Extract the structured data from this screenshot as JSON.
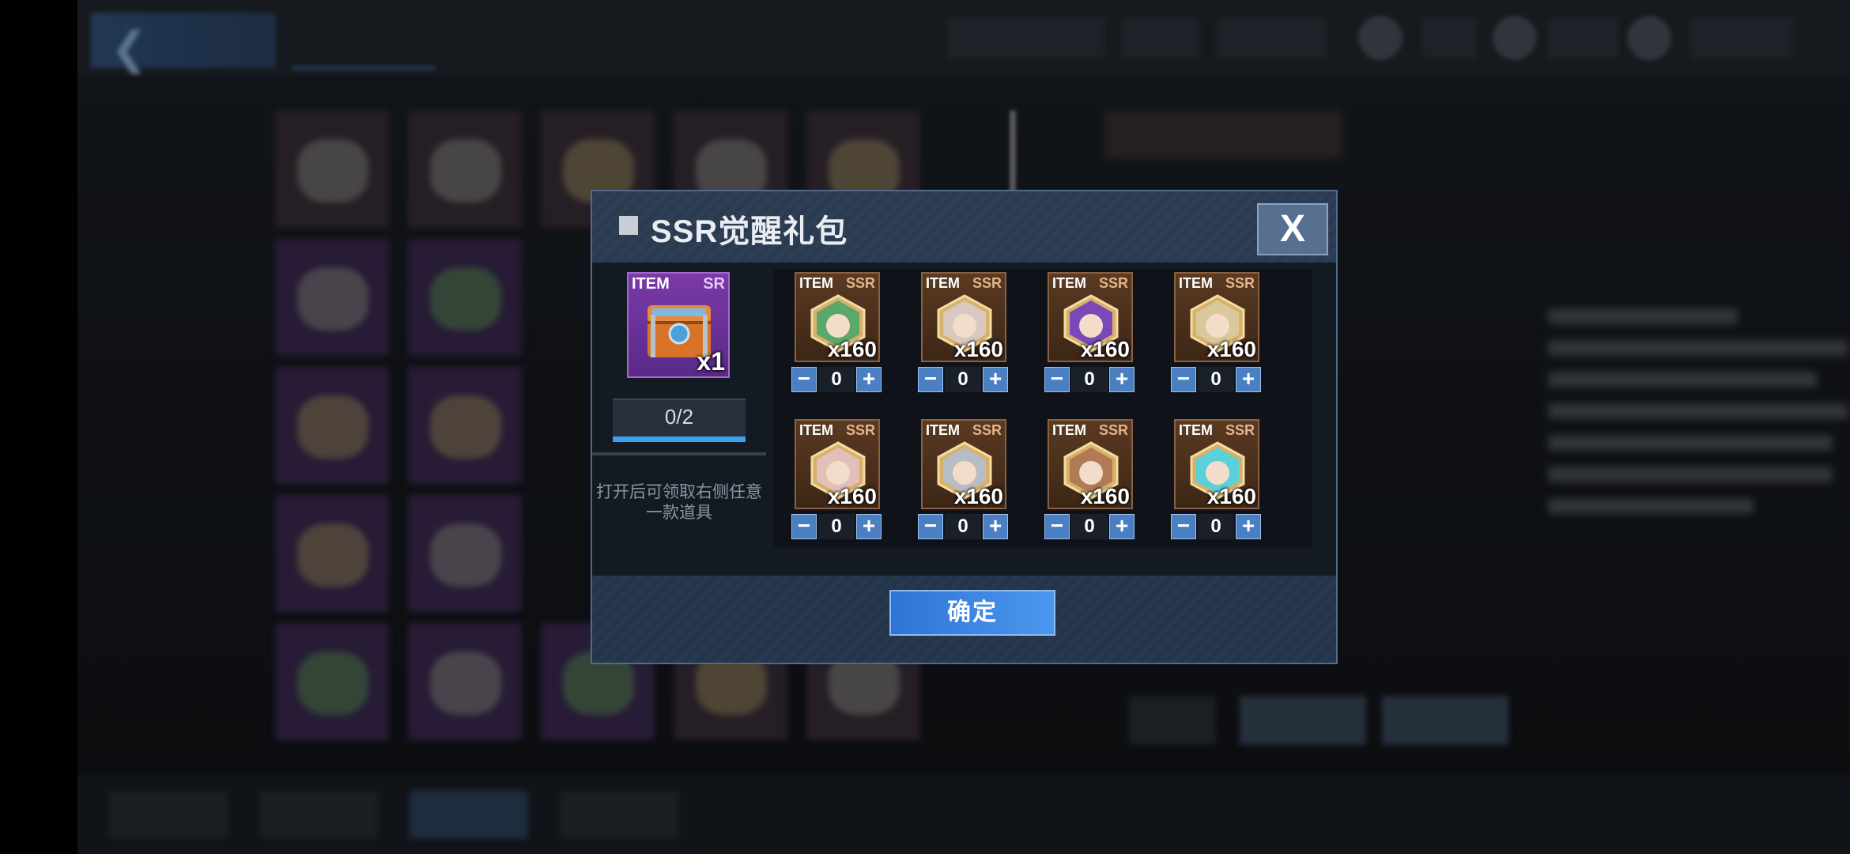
{
  "dialog": {
    "title": "SSR觉醒礼包",
    "close_label": "X",
    "confirm_label": "确定"
  },
  "source_item": {
    "tag": "ITEM",
    "rarity": "SR",
    "quantity": "x1",
    "icon": "treasure-chest-icon",
    "progress_text": "0/2",
    "progress_value": 0,
    "hint": "打开后可领取右侧任意一款道具"
  },
  "choices": [
    {
      "tag": "ITEM",
      "rarity": "SSR",
      "quantity": "x160",
      "icon": "character-portrait-green-hair",
      "count": "0",
      "color": "#5aa86a"
    },
    {
      "tag": "ITEM",
      "rarity": "SSR",
      "quantity": "x160",
      "icon": "character-portrait-silver-hair",
      "count": "0",
      "color": "#d8c8c0"
    },
    {
      "tag": "ITEM",
      "rarity": "SSR",
      "quantity": "x160",
      "icon": "character-portrait-purple-hair",
      "count": "0",
      "color": "#7a48b8"
    },
    {
      "tag": "ITEM",
      "rarity": "SSR",
      "quantity": "x160",
      "icon": "character-portrait-blonde-hair",
      "count": "0",
      "color": "#d8c89a"
    },
    {
      "tag": "ITEM",
      "rarity": "SSR",
      "quantity": "x160",
      "icon": "character-portrait-pink-hair",
      "count": "0",
      "color": "#e0c0b8"
    },
    {
      "tag": "ITEM",
      "rarity": "SSR",
      "quantity": "x160",
      "icon": "character-portrait-grey-hair",
      "count": "0",
      "color": "#b8bcc4"
    },
    {
      "tag": "ITEM",
      "rarity": "SSR",
      "quantity": "x160",
      "icon": "character-portrait-brown-hair",
      "count": "0",
      "color": "#b07a54"
    },
    {
      "tag": "ITEM",
      "rarity": "SSR",
      "quantity": "x160",
      "icon": "character-portrait-cyan-hair",
      "count": "0",
      "color": "#5ad0d8"
    }
  ],
  "colors": {
    "confirm_button": "#3a86e4",
    "modal_border": "#516a8c",
    "progress_fill": "#3aa0f0",
    "sr_card": "#6a30a0",
    "ssr_card": "#5a3a22"
  }
}
